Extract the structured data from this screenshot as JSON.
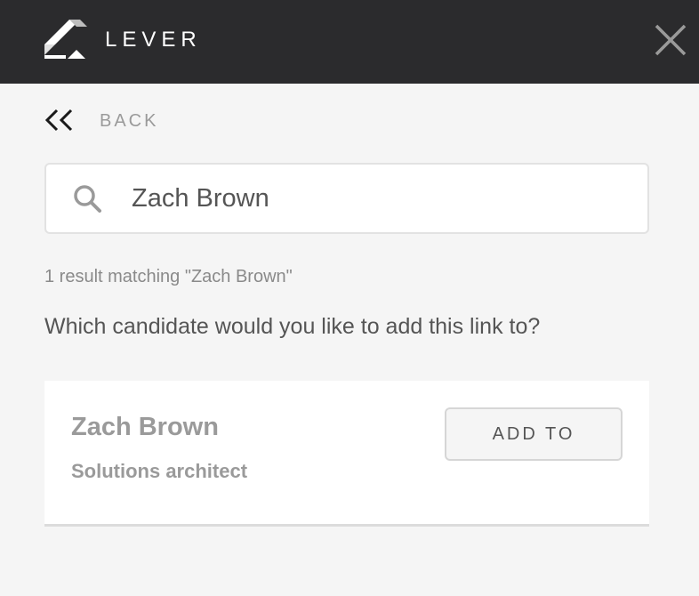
{
  "header": {
    "brand": "LEVER",
    "logo_icon": "lever-logo-icon",
    "close_icon": "close-icon"
  },
  "nav": {
    "back_label": "BACK",
    "back_icon": "double-chevron-left-icon"
  },
  "search": {
    "value": "Zach Brown",
    "icon": "search-icon"
  },
  "results": {
    "count_text": "1 result matching \"Zach Brown\"",
    "question": "Which candidate would you like to add this link to?",
    "candidates": [
      {
        "name": "Zach Brown",
        "role": "Solutions architect",
        "action_label": "ADD TO"
      }
    ]
  },
  "colors": {
    "header_bg": "#2b2b2d",
    "page_bg": "#f5f5f5",
    "muted_text": "#9a9a9a",
    "body_text": "#555555"
  }
}
